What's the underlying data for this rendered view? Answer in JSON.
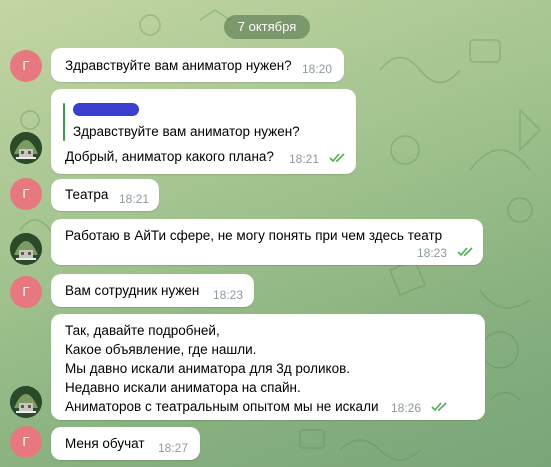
{
  "date_label": "7 октября",
  "avatar_letter": "Г",
  "messages": [
    {
      "text": "Здравствуйте вам аниматор нужен?",
      "time": "18:20"
    },
    {
      "quote": "Здравствуйте вам аниматор нужен?",
      "text": "Добрый, аниматор какого плана?",
      "time": "18:21"
    },
    {
      "text": "Театра",
      "time": "18:21"
    },
    {
      "text": "Работаю в АйТи сфере, не могу понять при чем здесь театр",
      "time": "18:23"
    },
    {
      "text": "Вам сотрудник нужен",
      "time": "18:23"
    },
    {
      "text": "Так, давайте подробней,\nКакое объявление, где нашли.\nМы давно искали аниматора для 3д роликов.\nНедавно искали аниматора на спайн.\nАниматоров с театральным опытом мы не искали",
      "time": "18:26"
    },
    {
      "text": "Меня обучат",
      "time": "18:27"
    }
  ],
  "colors": {
    "avatar_letter_bg": "#e8787f",
    "check_color": "#4fae4e",
    "date_pill_bg": "#4d6e48"
  }
}
